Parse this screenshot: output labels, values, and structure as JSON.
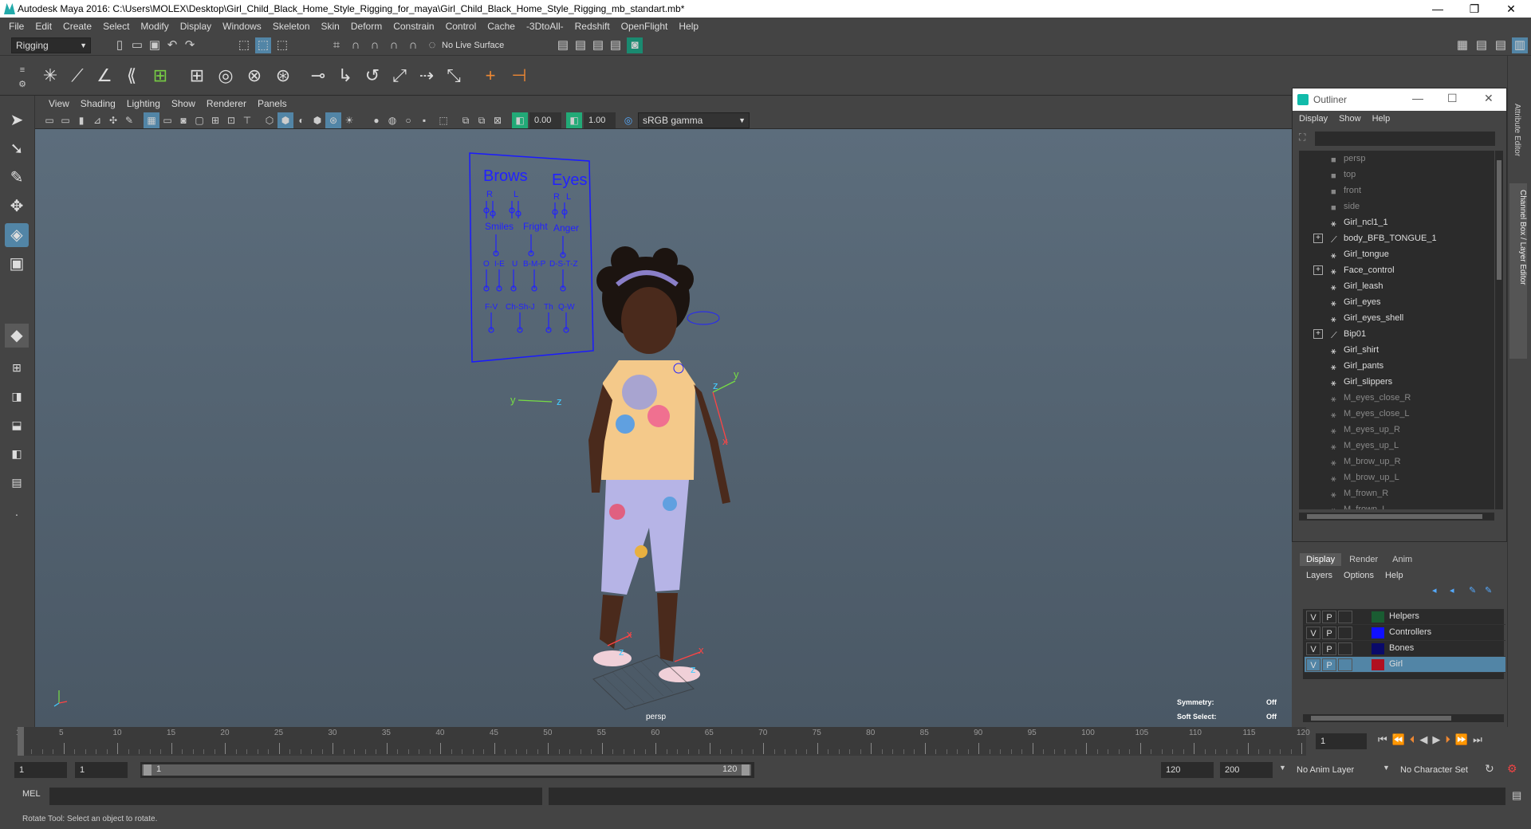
{
  "window": {
    "title": "Autodesk Maya 2016: C:\\Users\\MOLEX\\Desktop\\Girl_Child_Black_Home_Style_Rigging_for_maya\\Girl_Child_Black_Home_Style_Rigging_mb_standart.mb*",
    "minimize": "—",
    "restore": "❐",
    "close": "✕"
  },
  "menubar": [
    "File",
    "Edit",
    "Create",
    "Select",
    "Modify",
    "Display",
    "Windows",
    "Skeleton",
    "Skin",
    "Deform",
    "Constrain",
    "Control",
    "Cache",
    "-3DtoAll-",
    "Redshift",
    "OpenFlight",
    "Help"
  ],
  "statusline": {
    "menuset": "Rigging",
    "live_surface": "No Live Surface"
  },
  "viewport": {
    "menus": [
      "View",
      "Shading",
      "Lighting",
      "Show",
      "Renderer",
      "Panels"
    ],
    "exposure": "0.00",
    "gamma": "1.00",
    "color_space": "sRGB gamma",
    "camera": "persp",
    "symmetry_label": "Symmetry:",
    "symmetry_value": "Off",
    "soft_select_label": "Soft Select:",
    "soft_select_value": "Off",
    "face_panel": {
      "brows": "Brows",
      "eyes": "Eyes",
      "r1": "R",
      "l1": "L",
      "r2": "R",
      "l2": "L",
      "smiles": "Smiles",
      "fright": "Fright",
      "anger": "Anger",
      "o": "O",
      "i_e": "I-E",
      "u": "U",
      "b_m_p": "B-M-P",
      "d_s_t_z": "D-S-T-Z",
      "f_v": "F-V",
      "ch_sh_j": "Ch-Sh-J",
      "th": "Th",
      "q_w": "Q-W"
    },
    "axis_x": "x",
    "axis_y": "y",
    "axis_z": "z"
  },
  "outliner": {
    "title": "Outliner",
    "menus": [
      "Display",
      "Show",
      "Help"
    ],
    "items": [
      {
        "label": "persp",
        "icon": "camera-icon",
        "dim": true,
        "expand": false
      },
      {
        "label": "top",
        "icon": "camera-icon",
        "dim": true,
        "expand": false
      },
      {
        "label": "front",
        "icon": "camera-icon",
        "dim": true,
        "expand": false
      },
      {
        "label": "side",
        "icon": "camera-icon",
        "dim": true,
        "expand": false
      },
      {
        "label": "Girl_ncl1_1",
        "icon": "mesh-icon",
        "dim": false,
        "expand": false
      },
      {
        "label": "body_BFB_TONGUE_1",
        "icon": "joint-icon",
        "dim": false,
        "expand": true
      },
      {
        "label": "Girl_tongue",
        "icon": "mesh-icon",
        "dim": false,
        "expand": false
      },
      {
        "label": "Face_control",
        "icon": "mesh-icon",
        "dim": false,
        "expand": true
      },
      {
        "label": "Girl_leash",
        "icon": "mesh-icon",
        "dim": false,
        "expand": false
      },
      {
        "label": "Girl_eyes",
        "icon": "mesh-icon",
        "dim": false,
        "expand": false
      },
      {
        "label": "Girl_eyes_shell",
        "icon": "mesh-icon",
        "dim": false,
        "expand": false
      },
      {
        "label": "Bip01",
        "icon": "joint-icon",
        "dim": false,
        "expand": true
      },
      {
        "label": "Girl_shirt",
        "icon": "mesh-icon",
        "dim": false,
        "expand": false
      },
      {
        "label": "Girl_pants",
        "icon": "mesh-icon",
        "dim": false,
        "expand": false
      },
      {
        "label": "Girl_slippers",
        "icon": "mesh-icon",
        "dim": false,
        "expand": false
      },
      {
        "label": "M_eyes_close_R",
        "icon": "mesh-icon",
        "dim": true,
        "expand": false
      },
      {
        "label": "M_eyes_close_L",
        "icon": "mesh-icon",
        "dim": true,
        "expand": false
      },
      {
        "label": "M_eyes_up_R",
        "icon": "mesh-icon",
        "dim": true,
        "expand": false
      },
      {
        "label": "M_eyes_up_L",
        "icon": "mesh-icon",
        "dim": true,
        "expand": false
      },
      {
        "label": "M_brow_up_R",
        "icon": "mesh-icon",
        "dim": true,
        "expand": false
      },
      {
        "label": "M_brow_up_L",
        "icon": "mesh-icon",
        "dim": true,
        "expand": false
      },
      {
        "label": "M_frown_R",
        "icon": "mesh-icon",
        "dim": true,
        "expand": false
      },
      {
        "label": "M_frown_L",
        "icon": "mesh-icon",
        "dim": true,
        "expand": false
      }
    ]
  },
  "layer_editor": {
    "tabs": [
      "Display",
      "Render",
      "Anim"
    ],
    "menus": [
      "Layers",
      "Options",
      "Help"
    ],
    "layers": [
      {
        "v": "V",
        "p": "P",
        "name": "Helpers",
        "color": "#1a5c32",
        "selected": false
      },
      {
        "v": "V",
        "p": "P",
        "name": "Controllers",
        "color": "#1010ff",
        "selected": false
      },
      {
        "v": "V",
        "p": "P",
        "name": "Bones",
        "color": "#0a0a6a",
        "selected": false
      },
      {
        "v": "V",
        "p": "P",
        "name": "Girl",
        "color": "#b01020",
        "selected": true
      }
    ]
  },
  "right_strip": {
    "attribute_editor": "Attribute Editor",
    "channel_box": "Channel Box / Layer Editor"
  },
  "timeline": {
    "ticks": [
      1,
      5,
      10,
      15,
      20,
      25,
      30,
      35,
      40,
      45,
      50,
      55,
      60,
      65,
      70,
      75,
      80,
      85,
      90,
      95,
      100,
      105,
      110,
      115,
      120
    ],
    "current_frame": "1"
  },
  "range": {
    "start": "1",
    "playback_start": "1",
    "slider_start": "1",
    "slider_end": "120",
    "playback_end": "120",
    "end": "200",
    "anim_layer": "No Anim Layer",
    "character_set": "No Character Set"
  },
  "command": {
    "mode": "MEL"
  },
  "help_line": "Rotate Tool: Select an object to rotate."
}
